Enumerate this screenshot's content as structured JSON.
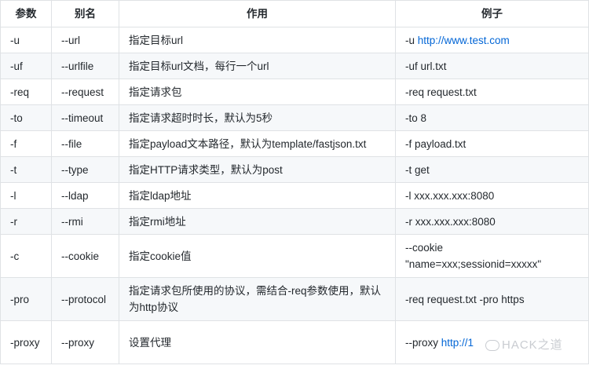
{
  "headers": [
    "参数",
    "别名",
    "作用",
    "例子"
  ],
  "rows": [
    {
      "param": "-u",
      "alias": "--url",
      "desc": "指定目标url",
      "example_prefix": "-u ",
      "example_link": "http://www.test.com"
    },
    {
      "param": "-uf",
      "alias": "--urlfile",
      "desc": "指定目标url文档，每行一个url",
      "example_prefix": "-uf url.txt",
      "example_link": ""
    },
    {
      "param": "-req",
      "alias": "--request",
      "desc": "指定请求包",
      "example_prefix": "-req request.txt",
      "example_link": ""
    },
    {
      "param": "-to",
      "alias": "--timeout",
      "desc": "指定请求超时时长，默认为5秒",
      "example_prefix": "-to 8",
      "example_link": ""
    },
    {
      "param": "-f",
      "alias": "--file",
      "desc": "指定payload文本路径，默认为template/fastjson.txt",
      "example_prefix": "-f payload.txt",
      "example_link": ""
    },
    {
      "param": "-t",
      "alias": "--type",
      "desc": "指定HTTP请求类型，默认为post",
      "example_prefix": "-t get",
      "example_link": ""
    },
    {
      "param": "-l",
      "alias": "--ldap",
      "desc": "指定ldap地址",
      "example_prefix": "-l xxx.xxx.xxx:8080",
      "example_link": ""
    },
    {
      "param": "-r",
      "alias": "--rmi",
      "desc": "指定rmi地址",
      "example_prefix": "-r xxx.xxx.xxx:8080",
      "example_link": ""
    },
    {
      "param": "-c",
      "alias": "--cookie",
      "desc": "指定cookie值",
      "example_prefix": "--cookie \"name=xxx;sessionid=xxxxx\"",
      "example_link": ""
    },
    {
      "param": "-pro",
      "alias": "--protocol",
      "desc": "指定请求包所使用的协议，需结合-req参数使用，默认为http协议",
      "example_prefix": "-req request.txt -pro https",
      "example_link": ""
    },
    {
      "param": "-proxy",
      "alias": "--proxy",
      "desc": "设置代理",
      "example_prefix": "--proxy ",
      "example_link": "http://1"
    }
  ],
  "watermark": "HACK之道",
  "colors": {
    "link": "#0366d6",
    "border": "#dfe2e5",
    "stripe": "#f6f8fa"
  }
}
